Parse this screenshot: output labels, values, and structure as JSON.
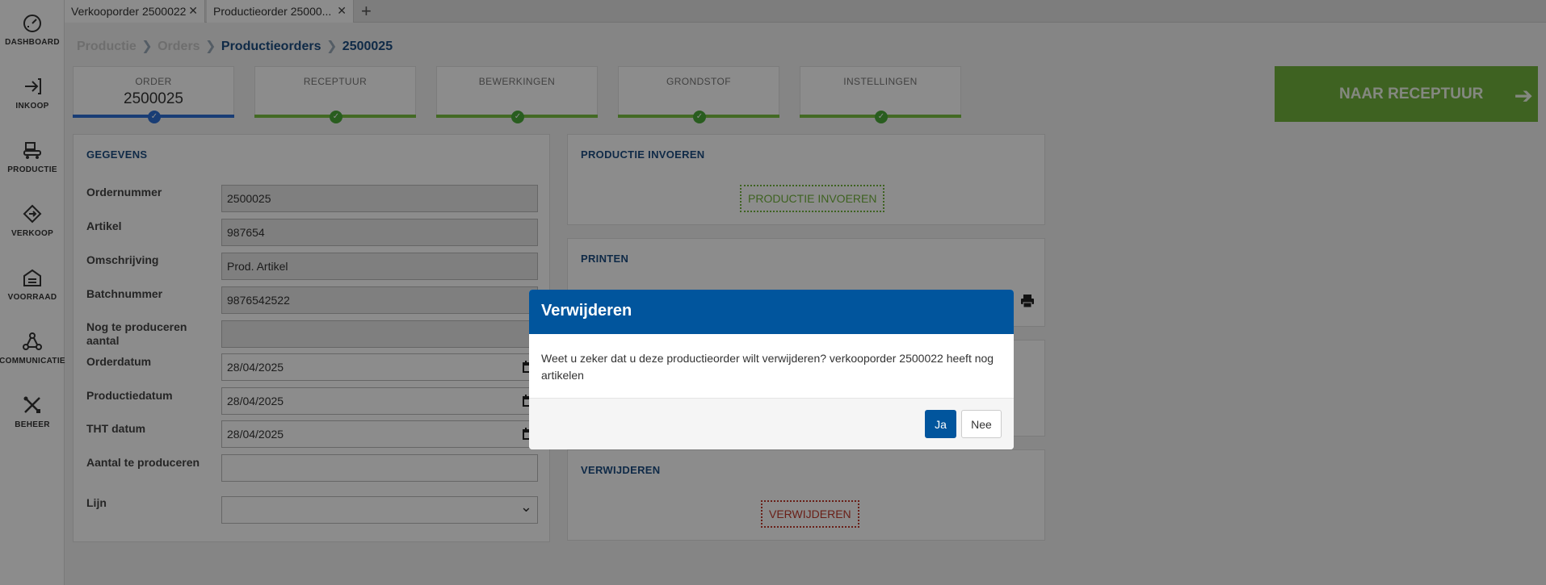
{
  "sidebar": {
    "items": [
      {
        "label": "DASHBOARD",
        "icon": "dashboard-icon"
      },
      {
        "label": "INKOOP",
        "icon": "inkoop-icon"
      },
      {
        "label": "PRODUCTIE",
        "icon": "productie-icon"
      },
      {
        "label": "VERKOOP",
        "icon": "verkoop-icon"
      },
      {
        "label": "VOORRAAD",
        "icon": "voorraad-icon"
      },
      {
        "label": "COMMUNICATIE",
        "icon": "communicatie-icon"
      },
      {
        "label": "BEHEER",
        "icon": "beheer-icon"
      }
    ]
  },
  "tabs": {
    "items": [
      {
        "label": "Verkooporder 2500022",
        "close": "✕"
      },
      {
        "label": "Productieorder 25000...",
        "close": "✕"
      }
    ],
    "add": "+"
  },
  "breadcrumb": {
    "items": [
      "Productie",
      "Orders",
      "Productieorders",
      "2500025"
    ],
    "separator": "❯"
  },
  "steps": {
    "items": [
      {
        "label": "ORDER",
        "value": "2500025",
        "status": "active",
        "check": "✓"
      },
      {
        "label": "RECEPTUUR",
        "status": "done",
        "check": "✓"
      },
      {
        "label": "BEWERKINGEN",
        "status": "done",
        "check": "✓"
      },
      {
        "label": "GRONDSTOF",
        "status": "done",
        "check": "✓"
      },
      {
        "label": "INSTELLINGEN",
        "status": "done",
        "check": "✓"
      }
    ]
  },
  "primary_action": {
    "label": "NAAR RECEPTUUR",
    "arrow": "➔"
  },
  "gegevens": {
    "title": "GEGEVENS",
    "fields": [
      {
        "label": "Ordernummer",
        "value": "2500025"
      },
      {
        "label": "Artikel",
        "value": "987654"
      },
      {
        "label": "Omschrijving",
        "value": "Prod. Artikel"
      },
      {
        "label": "Batchnummer",
        "value": "9876542522"
      },
      {
        "label": "Nog te produceren aantal",
        "value": ""
      },
      {
        "label": "Orderdatum",
        "value": "28/04/2025"
      },
      {
        "label": "Productiedatum",
        "value": "28/04/2025"
      },
      {
        "label": "THT datum",
        "value": "28/04/2025"
      },
      {
        "label": "Aantal te produceren",
        "value": ""
      },
      {
        "label": "Lijn",
        "value": "",
        "chevron": "⌄"
      }
    ]
  },
  "productie_invoeren": {
    "title": "PRODUCTIE INVOEREN",
    "button": "PRODUCTIE INVOEREN"
  },
  "printen": {
    "title": "PRINTEN"
  },
  "verwijderen": {
    "title": "VERWIJDEREN",
    "button": "VERWIJDEREN"
  },
  "dialog": {
    "title": "Verwijderen",
    "message": "Weet u zeker dat u deze productieorder wilt verwijderen? verkooporder 2500022 heeft nog artikelen",
    "yes": "Ja",
    "no": "Nee"
  },
  "colors": {
    "brand_blue": "#01559d",
    "green": "#72b33c",
    "danger": "#c0392b"
  }
}
